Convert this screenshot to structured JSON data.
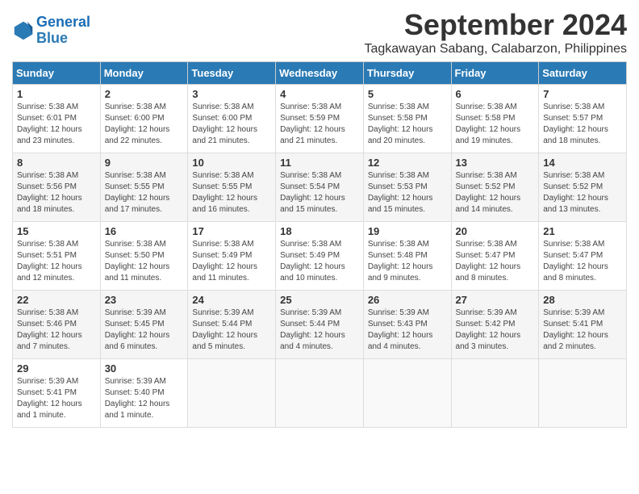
{
  "logo": {
    "line1": "General",
    "line2": "Blue"
  },
  "title": "September 2024",
  "subtitle": "Tagkawayan Sabang, Calabarzon, Philippines",
  "header": {
    "accent_color": "#2a7ab5"
  },
  "weekdays": [
    "Sunday",
    "Monday",
    "Tuesday",
    "Wednesday",
    "Thursday",
    "Friday",
    "Saturday"
  ],
  "weeks": [
    [
      {
        "day": "1",
        "info": "Sunrise: 5:38 AM\nSunset: 6:01 PM\nDaylight: 12 hours\nand 23 minutes."
      },
      {
        "day": "2",
        "info": "Sunrise: 5:38 AM\nSunset: 6:00 PM\nDaylight: 12 hours\nand 22 minutes."
      },
      {
        "day": "3",
        "info": "Sunrise: 5:38 AM\nSunset: 6:00 PM\nDaylight: 12 hours\nand 21 minutes."
      },
      {
        "day": "4",
        "info": "Sunrise: 5:38 AM\nSunset: 5:59 PM\nDaylight: 12 hours\nand 21 minutes."
      },
      {
        "day": "5",
        "info": "Sunrise: 5:38 AM\nSunset: 5:58 PM\nDaylight: 12 hours\nand 20 minutes."
      },
      {
        "day": "6",
        "info": "Sunrise: 5:38 AM\nSunset: 5:58 PM\nDaylight: 12 hours\nand 19 minutes."
      },
      {
        "day": "7",
        "info": "Sunrise: 5:38 AM\nSunset: 5:57 PM\nDaylight: 12 hours\nand 18 minutes."
      }
    ],
    [
      {
        "day": "8",
        "info": "Sunrise: 5:38 AM\nSunset: 5:56 PM\nDaylight: 12 hours\nand 18 minutes."
      },
      {
        "day": "9",
        "info": "Sunrise: 5:38 AM\nSunset: 5:55 PM\nDaylight: 12 hours\nand 17 minutes."
      },
      {
        "day": "10",
        "info": "Sunrise: 5:38 AM\nSunset: 5:55 PM\nDaylight: 12 hours\nand 16 minutes."
      },
      {
        "day": "11",
        "info": "Sunrise: 5:38 AM\nSunset: 5:54 PM\nDaylight: 12 hours\nand 15 minutes."
      },
      {
        "day": "12",
        "info": "Sunrise: 5:38 AM\nSunset: 5:53 PM\nDaylight: 12 hours\nand 15 minutes."
      },
      {
        "day": "13",
        "info": "Sunrise: 5:38 AM\nSunset: 5:52 PM\nDaylight: 12 hours\nand 14 minutes."
      },
      {
        "day": "14",
        "info": "Sunrise: 5:38 AM\nSunset: 5:52 PM\nDaylight: 12 hours\nand 13 minutes."
      }
    ],
    [
      {
        "day": "15",
        "info": "Sunrise: 5:38 AM\nSunset: 5:51 PM\nDaylight: 12 hours\nand 12 minutes."
      },
      {
        "day": "16",
        "info": "Sunrise: 5:38 AM\nSunset: 5:50 PM\nDaylight: 12 hours\nand 11 minutes."
      },
      {
        "day": "17",
        "info": "Sunrise: 5:38 AM\nSunset: 5:49 PM\nDaylight: 12 hours\nand 11 minutes."
      },
      {
        "day": "18",
        "info": "Sunrise: 5:38 AM\nSunset: 5:49 PM\nDaylight: 12 hours\nand 10 minutes."
      },
      {
        "day": "19",
        "info": "Sunrise: 5:38 AM\nSunset: 5:48 PM\nDaylight: 12 hours\nand 9 minutes."
      },
      {
        "day": "20",
        "info": "Sunrise: 5:38 AM\nSunset: 5:47 PM\nDaylight: 12 hours\nand 8 minutes."
      },
      {
        "day": "21",
        "info": "Sunrise: 5:38 AM\nSunset: 5:47 PM\nDaylight: 12 hours\nand 8 minutes."
      }
    ],
    [
      {
        "day": "22",
        "info": "Sunrise: 5:38 AM\nSunset: 5:46 PM\nDaylight: 12 hours\nand 7 minutes."
      },
      {
        "day": "23",
        "info": "Sunrise: 5:39 AM\nSunset: 5:45 PM\nDaylight: 12 hours\nand 6 minutes."
      },
      {
        "day": "24",
        "info": "Sunrise: 5:39 AM\nSunset: 5:44 PM\nDaylight: 12 hours\nand 5 minutes."
      },
      {
        "day": "25",
        "info": "Sunrise: 5:39 AM\nSunset: 5:44 PM\nDaylight: 12 hours\nand 4 minutes."
      },
      {
        "day": "26",
        "info": "Sunrise: 5:39 AM\nSunset: 5:43 PM\nDaylight: 12 hours\nand 4 minutes."
      },
      {
        "day": "27",
        "info": "Sunrise: 5:39 AM\nSunset: 5:42 PM\nDaylight: 12 hours\nand 3 minutes."
      },
      {
        "day": "28",
        "info": "Sunrise: 5:39 AM\nSunset: 5:41 PM\nDaylight: 12 hours\nand 2 minutes."
      }
    ],
    [
      {
        "day": "29",
        "info": "Sunrise: 5:39 AM\nSunset: 5:41 PM\nDaylight: 12 hours\nand 1 minute."
      },
      {
        "day": "30",
        "info": "Sunrise: 5:39 AM\nSunset: 5:40 PM\nDaylight: 12 hours\nand 1 minute."
      },
      {
        "day": "",
        "info": ""
      },
      {
        "day": "",
        "info": ""
      },
      {
        "day": "",
        "info": ""
      },
      {
        "day": "",
        "info": ""
      },
      {
        "day": "",
        "info": ""
      }
    ]
  ]
}
